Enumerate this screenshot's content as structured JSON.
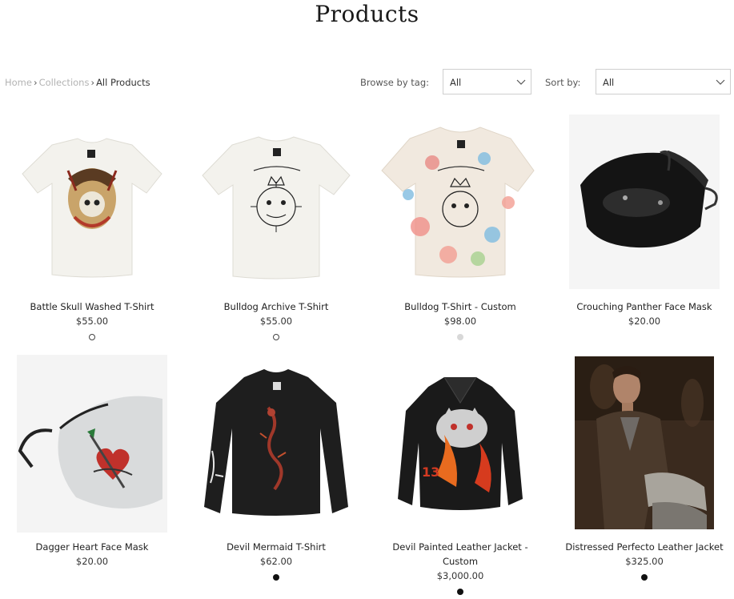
{
  "page": {
    "title": "Products"
  },
  "breadcrumb": {
    "home": "Home",
    "collections": "Collections",
    "current": "All Products",
    "separator": "›"
  },
  "filters": {
    "browse_label": "Browse by tag:",
    "browse_value": "All",
    "sort_label": "Sort by:",
    "sort_value": "All"
  },
  "products": [
    {
      "name": "Battle Skull Washed T-Shirt",
      "price": "$55.00",
      "swatch": "white"
    },
    {
      "name": "Bulldog Archive T-Shirt",
      "price": "$55.00",
      "swatch": "white"
    },
    {
      "name": "Bulldog T-Shirt - Custom",
      "price": "$98.00",
      "swatch": "grey"
    },
    {
      "name": "Crouching Panther Face Mask",
      "price": "$20.00",
      "swatch": ""
    },
    {
      "name": "Dagger Heart Face Mask",
      "price": "$20.00",
      "swatch": ""
    },
    {
      "name": "Devil Mermaid T-Shirt",
      "price": "$62.00",
      "swatch": "black"
    },
    {
      "name_line1": "Devil Painted Leather Jacket -",
      "name_line2": "Custom",
      "price": "$3,000.00",
      "swatch": "black"
    },
    {
      "name": "Distressed Perfecto Leather Jacket",
      "price": "$325.00",
      "swatch": "black"
    }
  ],
  "colors": {
    "swatch_white": "#ffffff",
    "swatch_grey": "#d8d8d8",
    "swatch_black": "#111111"
  }
}
